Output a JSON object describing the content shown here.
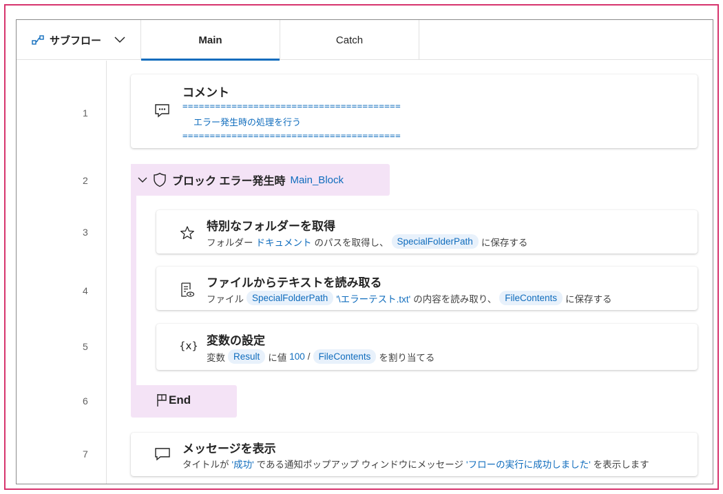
{
  "header": {
    "subflow_label": "サブフロー",
    "tabs": [
      {
        "label": "Main",
        "active": true
      },
      {
        "label": "Catch",
        "active": false
      }
    ]
  },
  "line_numbers": [
    "1",
    "2",
    "3",
    "4",
    "5",
    "6",
    "7"
  ],
  "steps": {
    "comment": {
      "title": "コメント",
      "line1": "========================================",
      "line2": "エラー発生時の処理を行う",
      "line3": "========================================"
    },
    "block": {
      "title": "ブロック エラー発生時",
      "name": "Main_Block"
    },
    "special_folder": {
      "title": "特別なフォルダーを取得",
      "desc_prefix": "フォルダー",
      "folder": "ドキュメント",
      "desc_mid": "のパスを取得し、",
      "variable": "SpecialFolderPath",
      "desc_suffix": "に保存する"
    },
    "read_text": {
      "title": "ファイルからテキストを読み取る",
      "desc_prefix": "ファイル",
      "variable": "SpecialFolderPath",
      "path_literal": "'\\エラーテスト.txt'",
      "desc_mid": "の内容を読み取り、",
      "out_variable": "FileContents",
      "desc_suffix": "に保存する"
    },
    "set_variable": {
      "title": "変数の設定",
      "desc_prefix": "変数",
      "variable": "Result",
      "desc_mid": "に値",
      "value": "100",
      "slash": "/",
      "operand": "FileContents",
      "desc_suffix": "を割り当てる"
    },
    "end": {
      "title": "End"
    },
    "message": {
      "title": "メッセージを表示",
      "desc_prefix": "タイトルが",
      "msg_title": "'成功'",
      "desc_mid": "である通知ポップアップ ウィンドウにメッセージ",
      "msg_text": "'フローの実行に成功しました'",
      "desc_suffix": "を表示します"
    }
  },
  "colors": {
    "frame": "#d6336c",
    "accent": "#0f6cbd",
    "pill_bg": "#e8f1fb",
    "block_bg": "#f4e3f6"
  },
  "icons": {
    "subflow": "subflow-icon",
    "chevron": "chevron-down-icon",
    "comment": "comment-icon",
    "block": "shield-icon",
    "special_folder": "star-icon",
    "read_text": "read-file-icon",
    "set_variable": "variable-icon",
    "end": "flag-icon",
    "message": "message-icon"
  }
}
